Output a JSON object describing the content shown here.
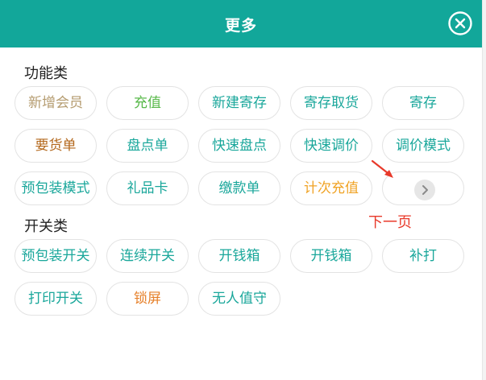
{
  "header": {
    "title": "更多",
    "close_icon": "close-circle-icon"
  },
  "sections": {
    "functions": {
      "title": "功能类",
      "items": [
        "新增会员",
        "充值",
        "新建寄存",
        "寄存取货",
        "寄存",
        "要货单",
        "盘点单",
        "快速盘点",
        "快速调价",
        "调价模式",
        "预包装模式",
        "礼品卡",
        "缴款单",
        "计次充值"
      ]
    },
    "switches": {
      "title": "开关类",
      "items": [
        "预包装开关",
        "连续开关",
        "开钱箱",
        "开钱箱",
        "补打",
        "打印开关",
        "锁屏",
        "无人值守"
      ]
    }
  },
  "next_page": {
    "icon": "chevron-right-icon"
  },
  "annotation": {
    "text": "下一页",
    "arrow": "red-arrow-icon"
  },
  "colors": {
    "header": "#12a79a",
    "teal": "#1aa79b",
    "tan": "#b59c70",
    "green": "#58b94a",
    "brown": "#b3671b",
    "orange": "#f0a325",
    "deep_orange": "#e6802a",
    "annotation_red": "#e8392a"
  }
}
